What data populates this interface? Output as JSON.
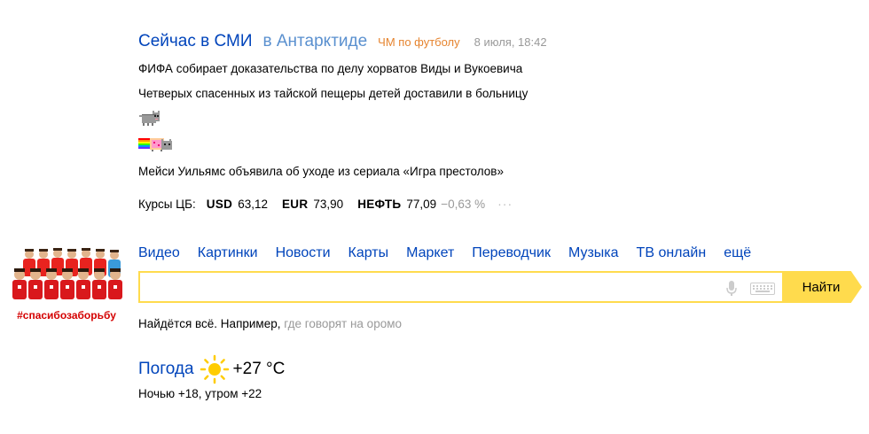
{
  "news": {
    "title": "Сейчас в СМИ",
    "region": "в Антарктиде",
    "topic": "ЧМ по футболу",
    "time": "8 июля, 18:42",
    "items": [
      "ФИФА собирает доказательства по делу хорватов Виды и Вукоевича",
      "Четверых спасенных из тайской пещеры детей доставили в больницу",
      "Мейси Уильямс объявила об уходе из сериала «Игра престолов»"
    ]
  },
  "rates": {
    "label": "Курсы ЦБ:",
    "usd_label": "USD",
    "usd_value": "63,12",
    "eur_label": "EUR",
    "eur_value": "73,90",
    "oil_label": "НЕФТЬ",
    "oil_value": "77,09",
    "oil_change": "−0,63 %",
    "more": "···"
  },
  "tabs": [
    "Видео",
    "Картинки",
    "Новости",
    "Карты",
    "Маркет",
    "Переводчик",
    "Музыка",
    "ТВ онлайн",
    "ещё"
  ],
  "search": {
    "value": "",
    "placeholder": "",
    "button": "Найти"
  },
  "hint": {
    "prefix": "Найдётся всё. Например,",
    "example": "где говорят на оромо"
  },
  "weather": {
    "title": "Погода",
    "temp": "+27 °C",
    "forecast": "Ночью +18,  утром +22"
  },
  "promo": {
    "tag": "#спасибозаборьбу"
  },
  "colors": {
    "link": "#0044bb",
    "accent": "#ffdb4d",
    "topic": "#e6842f",
    "muted": "#999999"
  }
}
